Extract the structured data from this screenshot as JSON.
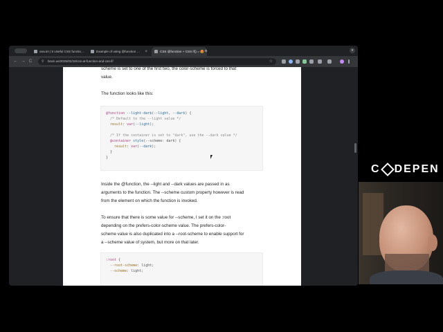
{
  "browser": {
    "tabs": [
      {
        "label": "ona.im | 5 Useful CSS functio…",
        "active": false
      },
      {
        "label": "Example of using @function …",
        "active": false
      },
      {
        "label": "CSS @function + CSS if() = 😍",
        "active": true
      }
    ],
    "new_tab_label": "+",
    "url": "bram.us/2025/02/18/css-at-function-and-css-if/",
    "back_label": "←",
    "forward_label": "→",
    "reload_label": "C"
  },
  "article": {
    "para1_line1": "scheme is set to one of the first two, the color-scheme is forced to that",
    "para1_line2": "value.",
    "para2": "The function looks like this:",
    "code1": [
      "@function --light-dark(--light, --dark) {",
      "  /* Default to the --light value */",
      "  result: var(--light);",
      "",
      "  /* If the container is set to \"dark\", use the --dark value */",
      "  @container style(--scheme: dark) {",
      "    result: var(--dark);",
      "  }",
      "}"
    ],
    "para3_line1": "Inside the @function, the --light and --dark values are passed in as",
    "para3_line2": "arguments to the function. The --scheme custom property however is read",
    "para3_line3": "from the element on which the function is invoked.",
    "para4_line1": "To ensure that there is some value for --scheme, I set it on the :root",
    "para4_line2": "depending on the prefers-color-scheme value. The prefers-color-",
    "para4_line3": "scheme value is also duplicated into a --root-scheme to enable support for",
    "para4_line4": "a --scheme value of system, but more on that later.",
    "code2": [
      ":root {",
      "  --root-scheme: light;",
      "  --scheme: light;"
    ]
  },
  "overlay": {
    "logo_left": "C",
    "logo_right": "DEPEN"
  },
  "colors": {
    "page_bg": "#ffffff",
    "browser_chrome": "#202124",
    "code_bg": "#f6f6f6"
  }
}
